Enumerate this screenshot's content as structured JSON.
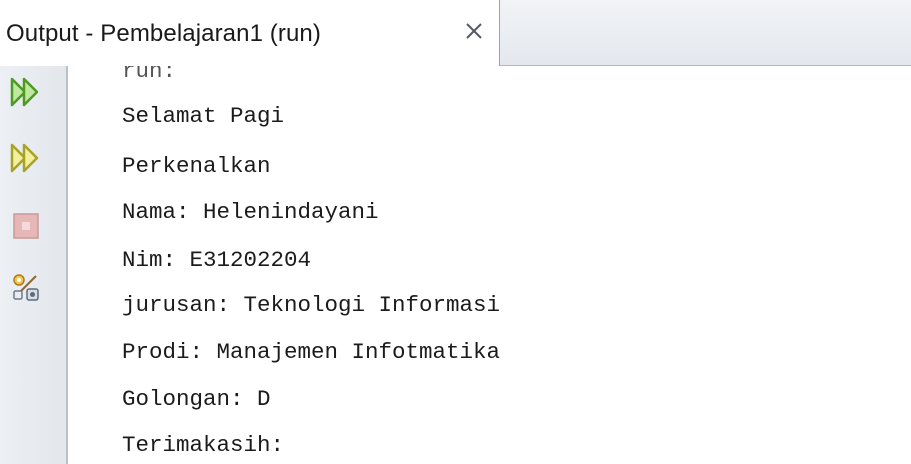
{
  "tab": {
    "title": "Output - Pembelajaran1 (run)",
    "close_icon": "close-icon"
  },
  "toolbar": {
    "items": [
      {
        "name": "rerun-icon",
        "color": "#5fae2f"
      },
      {
        "name": "rerun-with-options-icon",
        "color": "#c8c23a"
      },
      {
        "name": "stop-icon",
        "color": "#d9a0a0"
      },
      {
        "name": "settings-icon",
        "color": "#b07a3a"
      }
    ]
  },
  "output": {
    "lines": [
      "run:",
      "Selamat Pagi",
      "Perkenalkan",
      "Nama: Helenindayani",
      "Nim: E31202204",
      "jurusan: Teknologi Informasi",
      "Prodi: Manajemen Infotmatika",
      "Golongan: D",
      "Terimakasih:"
    ]
  }
}
